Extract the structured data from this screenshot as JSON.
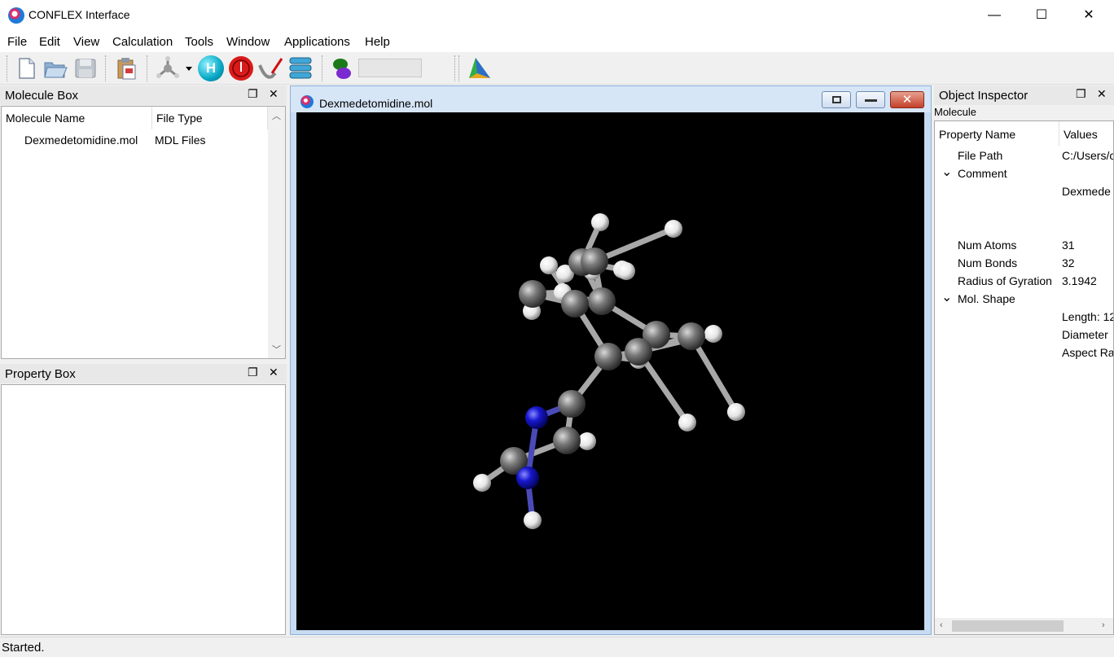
{
  "window": {
    "title": "CONFLEX Interface",
    "minimize": "—",
    "maximize": "☐",
    "close": "✕"
  },
  "menu": [
    "File",
    "Edit",
    "View",
    "Calculation",
    "Tools",
    "Window",
    "Applications",
    "Help"
  ],
  "toolbar": {
    "icons": [
      "new-file-icon",
      "open-folder-icon",
      "save-icon",
      "clipboard-icon",
      "molecule-builder-icon",
      "add-hydrogen-icon",
      "atom-icon",
      "clean-icon",
      "layers-icon",
      "orbital-icon",
      "triangle-icon"
    ],
    "h_label": "H",
    "input_value": ""
  },
  "molecule_box": {
    "title": "Molecule Box",
    "columns": [
      "Molecule Name",
      "File Type"
    ],
    "rows": [
      {
        "name": "Dexmedetomidine.mol",
        "type": "MDL Files"
      }
    ]
  },
  "property_box": {
    "title": "Property Box"
  },
  "viewer": {
    "title": "Dexmedetomidine.mol"
  },
  "inspector": {
    "title": "Object Inspector",
    "subtitle": "Molecule",
    "columns": [
      "Property Name",
      "Values"
    ],
    "rows": [
      {
        "name": "File Path",
        "value": "C:/Users/c",
        "expander": ""
      },
      {
        "name": "Comment",
        "value": "",
        "expander": "⌄"
      },
      {
        "name": "",
        "value": "Dexmede",
        "expander": ""
      },
      {
        "name": "Num Atoms",
        "value": "31",
        "expander": ""
      },
      {
        "name": "Num Bonds",
        "value": "32",
        "expander": ""
      },
      {
        "name": "Radius of Gyration",
        "value": "3.1942",
        "expander": ""
      },
      {
        "name": "Mol. Shape",
        "value": "",
        "expander": "⌄"
      },
      {
        "name": "",
        "value": "Length: 12",
        "expander": ""
      },
      {
        "name": "",
        "value": "Diameter",
        "expander": ""
      },
      {
        "name": "",
        "value": "Aspect Ra",
        "expander": ""
      }
    ]
  },
  "status": {
    "text": "Started."
  },
  "colors": {
    "carbon": "#7a7a7a",
    "nitrogen": "#1515c8",
    "hydrogen": "#f2f2f2",
    "background": "#000000"
  }
}
